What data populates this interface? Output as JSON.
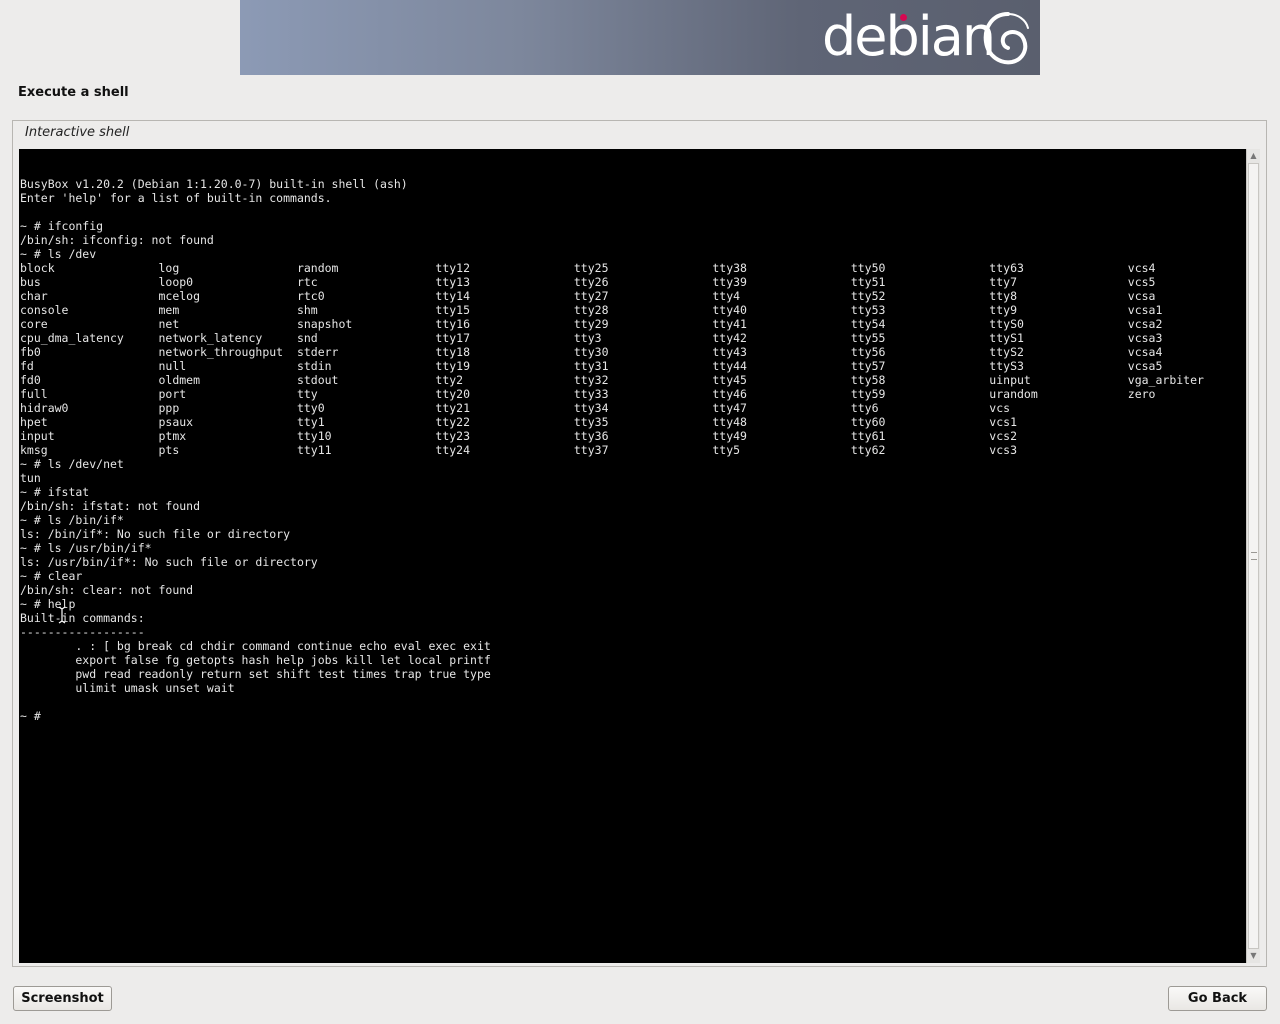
{
  "banner": {
    "logo_text": "debian",
    "logo_icon": "debian-swirl-icon"
  },
  "page_title": "Execute a shell",
  "frame_title": "Interactive shell",
  "terminal": {
    "lines": [
      "BusyBox v1.20.2 (Debian 1:1.20.0-7) built-in shell (ash)",
      "Enter 'help' for a list of built-in commands.",
      "",
      "~ # ifconfig",
      "/bin/sh: ifconfig: not found",
      "~ # ls /dev",
      "block               log                 random              tty12               tty25               tty38               tty50               tty63               vcs4",
      "bus                 loop0               rtc                 tty13               tty26               tty39               tty51               tty7                vcs5",
      "char                mcelog              rtc0                tty14               tty27               tty4                tty52               tty8                vcsa",
      "console             mem                 shm                 tty15               tty28               tty40               tty53               tty9                vcsa1",
      "core                net                 snapshot            tty16               tty29               tty41               tty54               ttyS0               vcsa2",
      "cpu_dma_latency     network_latency     snd                 tty17               tty3                tty42               tty55               ttyS1               vcsa3",
      "fb0                 network_throughput  stderr              tty18               tty30               tty43               tty56               ttyS2               vcsa4",
      "fd                  null                stdin               tty19               tty31               tty44               tty57               ttyS3               vcsa5",
      "fd0                 oldmem              stdout              tty2                tty32               tty45               tty58               uinput              vga_arbiter",
      "full                port                tty                 tty20               tty33               tty46               tty59               urandom             zero",
      "hidraw0             ppp                 tty0                tty21               tty34               tty47               tty6                vcs",
      "hpet                psaux               tty1                tty22               tty35               tty48               tty60               vcs1",
      "input               ptmx                tty10               tty23               tty36               tty49               tty61               vcs2",
      "kmsg                pts                 tty11               tty24               tty37               tty5                tty62               vcs3",
      "~ # ls /dev/net",
      "tun",
      "~ # ifstat",
      "/bin/sh: ifstat: not found",
      "~ # ls /bin/if*",
      "ls: /bin/if*: No such file or directory",
      "~ # ls /usr/bin/if*",
      "ls: /usr/bin/if*: No such file or directory",
      "~ # clear",
      "/bin/sh: clear: not found",
      "~ # help",
      "Built-in commands:",
      "------------------",
      "        . : [ bg break cd chdir command continue echo eval exec exit",
      "        export false fg getopts hash help jobs kill let local printf",
      "        pwd read readonly return set shift test times trap true type",
      "        ulimit umask unset wait",
      "",
      "~ #"
    ]
  },
  "buttons": {
    "screenshot": "Screenshot",
    "go_back": "Go Back"
  }
}
